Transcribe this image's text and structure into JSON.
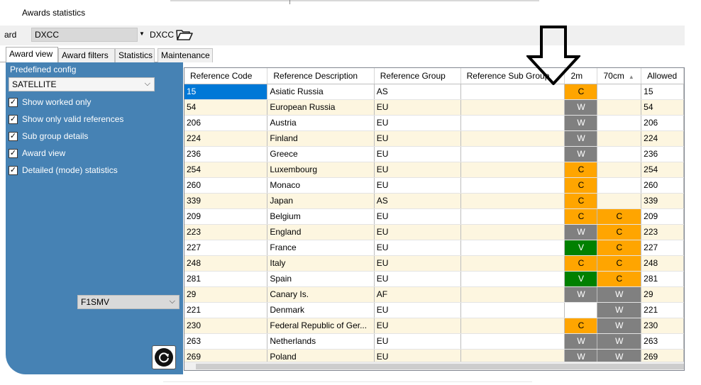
{
  "window": {
    "title": "Awards statistics"
  },
  "award": {
    "label": "ard",
    "selected": "DXCC",
    "name": "DXCC",
    "folder_icon": "folder-open-icon"
  },
  "tabs": [
    {
      "label": "Award view",
      "active": true
    },
    {
      "label": "Award filters",
      "active": false
    },
    {
      "label": "Statistics",
      "active": false
    },
    {
      "label": "Maintenance",
      "active": false
    }
  ],
  "left_panel": {
    "predefined_label": "Predefined config",
    "predefined_value": "SATELLITE",
    "options": [
      {
        "label": "Show worked only",
        "checked": true
      },
      {
        "label": "Show only valid references",
        "checked": true
      },
      {
        "label": "Sub group details",
        "checked": true
      },
      {
        "label": "Award view",
        "checked": true
      },
      {
        "label": "Detailed (mode) statistics",
        "checked": true
      }
    ],
    "callsign": "F1SMV",
    "refresh_icon": "refresh-icon",
    "background": "#4682b4"
  },
  "grid": {
    "columns": [
      "Reference Code",
      "Reference Description",
      "Reference Group",
      "Reference Sub Group",
      "2m",
      "70cm",
      "Allowed"
    ],
    "sort_column": "70cm",
    "colors": {
      "C": "#ffa500",
      "W": "#808080",
      "V": "#008000"
    },
    "rows": [
      {
        "code": "15",
        "desc": "Asiatic Russia",
        "group": "AS",
        "sub": "",
        "b2m": "C",
        "b70": "",
        "allowed": "15"
      },
      {
        "code": "54",
        "desc": "European Russia",
        "group": "EU",
        "sub": "",
        "b2m": "W",
        "b70": "",
        "allowed": "54"
      },
      {
        "code": "206",
        "desc": "Austria",
        "group": "EU",
        "sub": "",
        "b2m": "W",
        "b70": "",
        "allowed": "206"
      },
      {
        "code": "224",
        "desc": "Finland",
        "group": "EU",
        "sub": "",
        "b2m": "W",
        "b70": "",
        "allowed": "224"
      },
      {
        "code": "236",
        "desc": "Greece",
        "group": "EU",
        "sub": "",
        "b2m": "W",
        "b70": "",
        "allowed": "236"
      },
      {
        "code": "254",
        "desc": "Luxembourg",
        "group": "EU",
        "sub": "",
        "b2m": "C",
        "b70": "",
        "allowed": "254"
      },
      {
        "code": "260",
        "desc": "Monaco",
        "group": "EU",
        "sub": "",
        "b2m": "C",
        "b70": "",
        "allowed": "260"
      },
      {
        "code": "339",
        "desc": "Japan",
        "group": "AS",
        "sub": "",
        "b2m": "C",
        "b70": "",
        "allowed": "339"
      },
      {
        "code": "209",
        "desc": "Belgium",
        "group": "EU",
        "sub": "",
        "b2m": "C",
        "b70": "C",
        "allowed": "209"
      },
      {
        "code": "223",
        "desc": "England",
        "group": "EU",
        "sub": "",
        "b2m": "W",
        "b70": "C",
        "allowed": "223"
      },
      {
        "code": "227",
        "desc": "France",
        "group": "EU",
        "sub": "",
        "b2m": "V",
        "b70": "C",
        "allowed": "227"
      },
      {
        "code": "248",
        "desc": "Italy",
        "group": "EU",
        "sub": "",
        "b2m": "C",
        "b70": "C",
        "allowed": "248"
      },
      {
        "code": "281",
        "desc": "Spain",
        "group": "EU",
        "sub": "",
        "b2m": "V",
        "b70": "C",
        "allowed": "281"
      },
      {
        "code": "29",
        "desc": "Canary Is.",
        "group": "AF",
        "sub": "",
        "b2m": "W",
        "b70": "W",
        "allowed": "29"
      },
      {
        "code": "221",
        "desc": "Denmark",
        "group": "EU",
        "sub": "",
        "b2m": "",
        "b70": "W",
        "allowed": "221"
      },
      {
        "code": "230",
        "desc": "Federal Republic of Ger...",
        "group": "EU",
        "sub": "",
        "b2m": "C",
        "b70": "W",
        "allowed": "230"
      },
      {
        "code": "263",
        "desc": "Netherlands",
        "group": "EU",
        "sub": "",
        "b2m": "W",
        "b70": "W",
        "allowed": "263"
      },
      {
        "code": "269",
        "desc": "Poland",
        "group": "EU",
        "sub": "",
        "b2m": "W",
        "b70": "W",
        "allowed": "269"
      }
    ]
  },
  "annotation": {
    "arrow_icon": "down-arrow-icon"
  }
}
